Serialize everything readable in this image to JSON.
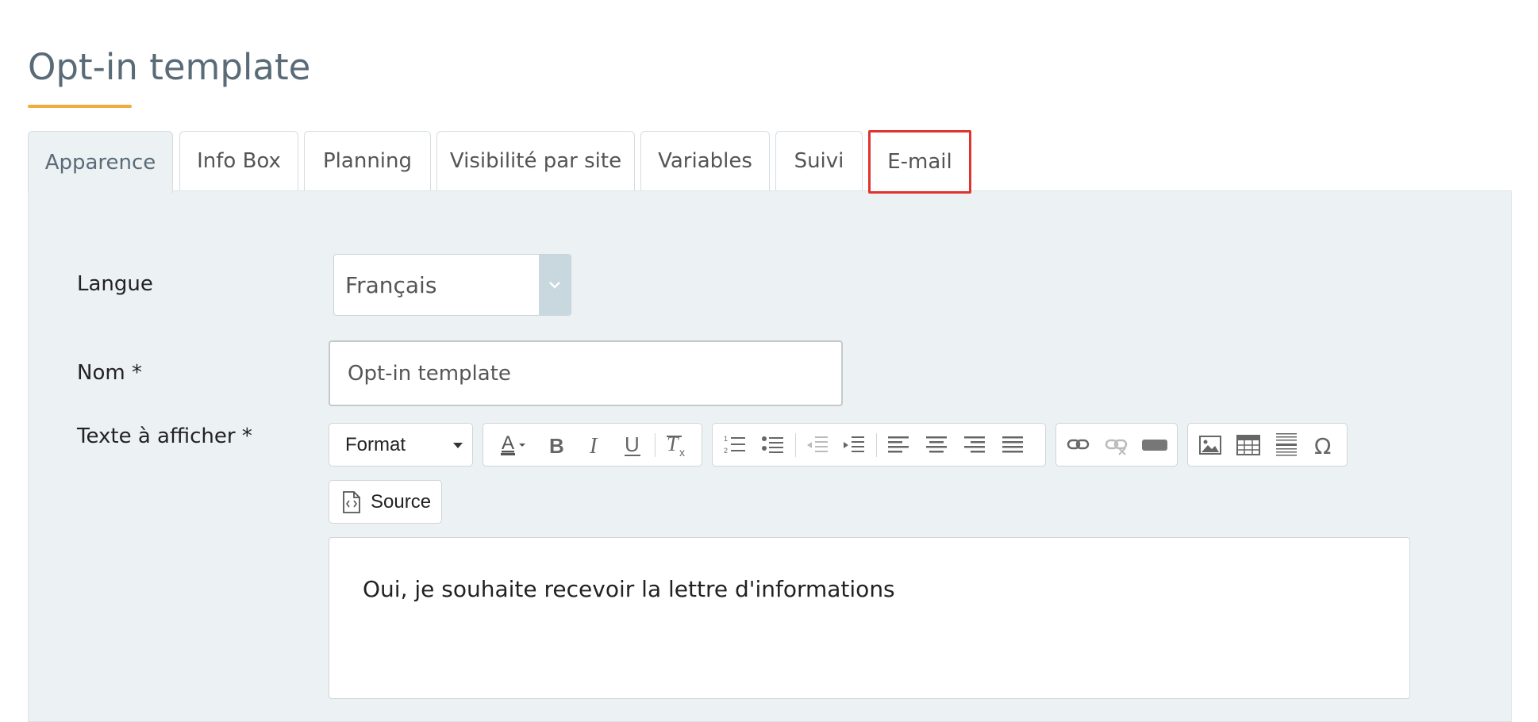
{
  "page": {
    "title": "Opt-in template"
  },
  "tabs": [
    {
      "label": "Apparence",
      "active": true
    },
    {
      "label": "Info Box"
    },
    {
      "label": "Planning"
    },
    {
      "label": "Visibilité par site"
    },
    {
      "label": "Variables"
    },
    {
      "label": "Suivi"
    },
    {
      "label": "E-mail",
      "highlighted": true
    }
  ],
  "form": {
    "langue_label": "Langue",
    "langue_value": "Français",
    "nom_label": "Nom *",
    "nom_value": "Opt-in template",
    "texte_label": "Texte à afficher *"
  },
  "editor": {
    "format_label": "Format",
    "source_label": "Source",
    "content": "Oui, je souhaite recevoir la lettre d'informations",
    "toolbar_icons": [
      "text-color-icon",
      "bold-icon",
      "italic-icon",
      "underline-icon",
      "remove-format-icon",
      "numbered-list-icon",
      "bulleted-list-icon",
      "outdent-icon",
      "indent-icon",
      "align-left-icon",
      "align-center-icon",
      "align-right-icon",
      "justify-icon",
      "link-icon",
      "unlink-icon",
      "anchor-icon",
      "image-icon",
      "table-icon",
      "horizontal-rule-icon",
      "special-char-icon"
    ]
  },
  "colors": {
    "accent_underline": "#f0ad3c",
    "title": "#5a6b78",
    "panel_bg": "#ecf1f4",
    "highlight_border": "#e0332e"
  }
}
